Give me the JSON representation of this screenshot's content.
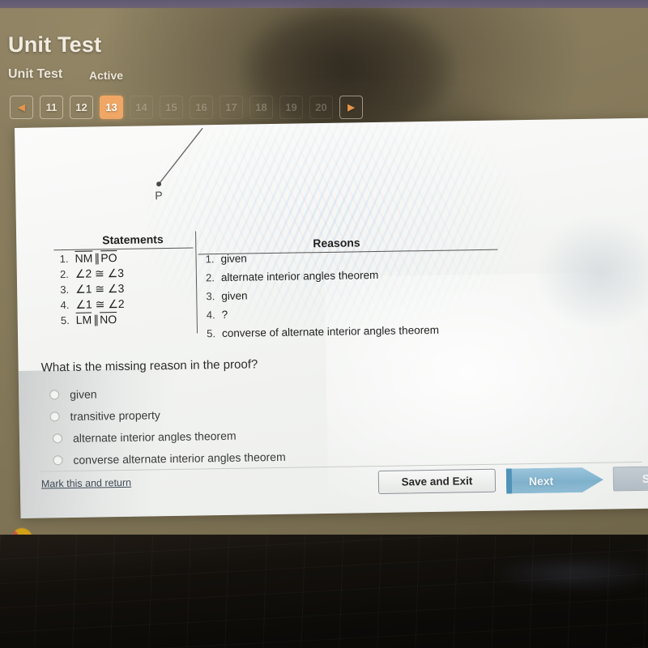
{
  "header": {
    "title": "Unit Test",
    "subtitle": "Unit Test",
    "status": "Active"
  },
  "pagination": {
    "prev_icon": "◀",
    "next_icon": "▶",
    "pages": [
      "11",
      "12",
      "13",
      "14",
      "15",
      "16",
      "17",
      "18",
      "19",
      "20"
    ],
    "active_page": "13",
    "active_color": "#f0a765"
  },
  "figure": {
    "point_label": "P"
  },
  "proof_table": {
    "statements_header": "Statements",
    "reasons_header": "Reasons",
    "statements": [
      {
        "num": "1.",
        "pre": "NM",
        "op": "∥",
        "post": "PO",
        "overline": true
      },
      {
        "num": "2.",
        "text": "∠2 ≅ ∠3",
        "overline": false
      },
      {
        "num": "3.",
        "text": "∠1 ≅ ∠3",
        "overline": false
      },
      {
        "num": "4.",
        "text": "∠1 ≅ ∠2",
        "overline": false
      },
      {
        "num": "5.",
        "pre": "LM",
        "op": "∥",
        "post": "NO",
        "overline": true
      }
    ],
    "reasons": [
      {
        "num": "1.",
        "text": "given"
      },
      {
        "num": "2.",
        "text": "alternate interior angles theorem"
      },
      {
        "num": "3.",
        "text": "given"
      },
      {
        "num": "4.",
        "text": "?"
      },
      {
        "num": "5.",
        "text": "converse of alternate interior angles theorem"
      }
    ]
  },
  "question": {
    "prompt": "What is the missing reason in the proof?",
    "options": [
      {
        "label": "given",
        "selected": false
      },
      {
        "label": "transitive property",
        "selected": false
      },
      {
        "label": "alternate interior angles theorem",
        "selected": false
      },
      {
        "label": "converse alternate interior angles theorem",
        "selected": false
      }
    ]
  },
  "footer": {
    "mark_link": "Mark this and return",
    "save_button": "Save and Exit",
    "next_button": "Next",
    "submit_button": "Su",
    "next_color": "#7fb1cc"
  },
  "taskbar": {
    "chrome_icon": "chrome-icon"
  }
}
